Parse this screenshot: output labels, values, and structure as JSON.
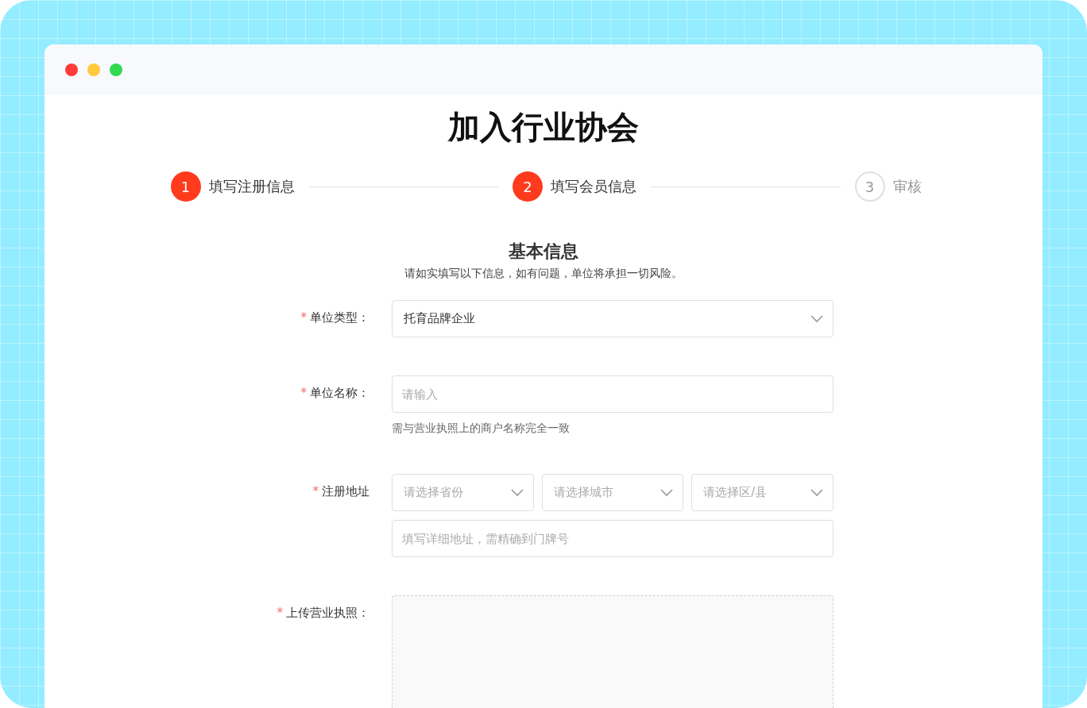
{
  "title": "加入行业协会",
  "steps": [
    {
      "number": "1",
      "label": "填写注册信息",
      "active": true
    },
    {
      "number": "2",
      "label": "填写会员信息",
      "active": true
    },
    {
      "number": "3",
      "label": "审核",
      "active": false
    }
  ],
  "section": {
    "title": "基本信息",
    "subtitle": "请如实填写以下信息，如有问题，单位将承担一切风险。"
  },
  "fields": [
    {
      "label": "单位类型：",
      "required_mark": "*",
      "controls": [
        {
          "kind": "select",
          "value": "托育品牌企业"
        }
      ]
    },
    {
      "label": "单位名称：",
      "required_mark": "*",
      "controls": [
        {
          "kind": "input",
          "placeholder": "请输入"
        }
      ],
      "hint": "需与营业执照上的商户名称完全一致"
    },
    {
      "label": "注册地址",
      "required_mark": "*",
      "controls": [
        {
          "kind": "select",
          "placeholder": "请选择省份"
        },
        {
          "kind": "select",
          "placeholder": "请选择城市"
        },
        {
          "kind": "select",
          "placeholder": "请选择区/县"
        },
        {
          "kind": "input",
          "placeholder": "填写详细地址，需精确到门牌号"
        }
      ]
    },
    {
      "label": "上传营业执照：",
      "required_mark": "*",
      "controls": [
        {
          "kind": "upload"
        }
      ]
    }
  ]
}
